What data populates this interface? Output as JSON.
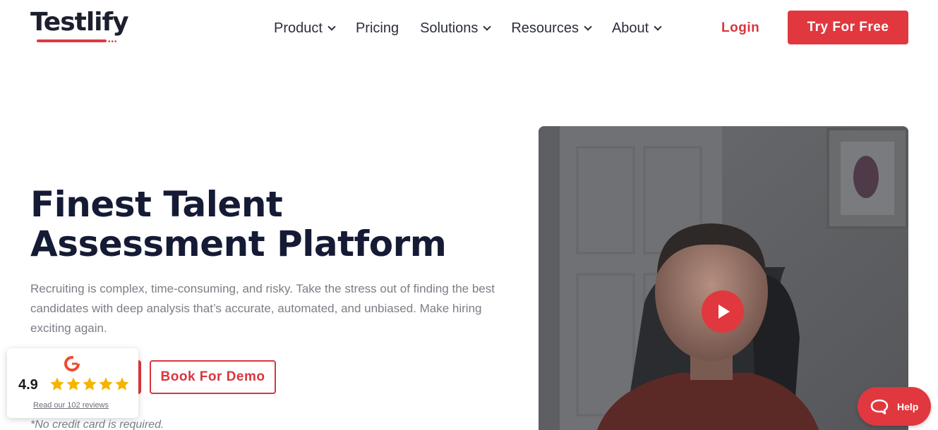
{
  "brand": {
    "name": "Testlify",
    "accent": "#e0383e",
    "dark": "#151b35"
  },
  "nav": {
    "items": [
      {
        "label": "Product",
        "has_dropdown": true
      },
      {
        "label": "Pricing",
        "has_dropdown": false
      },
      {
        "label": "Solutions",
        "has_dropdown": true
      },
      {
        "label": "Resources",
        "has_dropdown": true
      },
      {
        "label": "About",
        "has_dropdown": true
      }
    ],
    "login": "Login",
    "cta": "Try For Free"
  },
  "hero": {
    "title_line1": "Finest Talent",
    "title_line2": "Assessment Platform",
    "description": "Recruiting is complex, time-consuming, and risky. Take the stress out of finding the best candidates with deep analysis that’s accurate, automated, and unbiased. Make hiring exciting again.",
    "demo_button": "Book For Demo",
    "note": "*No credit card is required."
  },
  "g2_badge": {
    "logo_icon": "g2-logo-icon",
    "rating": "4.9",
    "stars": 5,
    "reviews_link": "Read our 102 reviews"
  },
  "video": {
    "play_icon": "play-icon"
  },
  "help": {
    "label": "Help",
    "icon": "chat-bubble-icon"
  }
}
